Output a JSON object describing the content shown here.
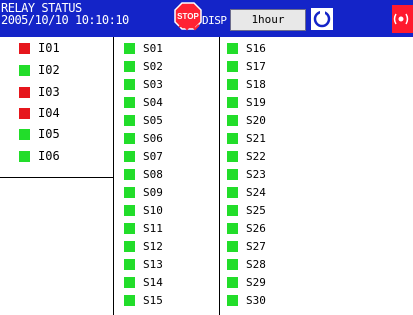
{
  "header": {
    "title": "RELAY STATUS",
    "datetime": "2005/10/10 10:10:10",
    "stop_icon_label": "STOP",
    "disp_label": "DISP",
    "disp_value": "1hour"
  },
  "colors": {
    "header_bg": "#1424c8",
    "status_on": "#22dd2a",
    "status_alarm": "#e6161c",
    "alarm_icon": "#ff1a2e"
  },
  "inputs": [
    {
      "label": "I01",
      "state": "alarm"
    },
    {
      "label": "I02",
      "state": "on"
    },
    {
      "label": "I03",
      "state": "alarm"
    },
    {
      "label": "I04",
      "state": "alarm"
    },
    {
      "label": "I05",
      "state": "on"
    },
    {
      "label": "I06",
      "state": "on"
    }
  ],
  "relays_col1": [
    {
      "label": "S01",
      "state": "on"
    },
    {
      "label": "S02",
      "state": "on"
    },
    {
      "label": "S03",
      "state": "on"
    },
    {
      "label": "S04",
      "state": "on"
    },
    {
      "label": "S05",
      "state": "on"
    },
    {
      "label": "S06",
      "state": "on"
    },
    {
      "label": "S07",
      "state": "on"
    },
    {
      "label": "S08",
      "state": "on"
    },
    {
      "label": "S09",
      "state": "on"
    },
    {
      "label": "S10",
      "state": "on"
    },
    {
      "label": "S11",
      "state": "on"
    },
    {
      "label": "S12",
      "state": "on"
    },
    {
      "label": "S13",
      "state": "on"
    },
    {
      "label": "S14",
      "state": "on"
    },
    {
      "label": "S15",
      "state": "on"
    }
  ],
  "relays_col2": [
    {
      "label": "S16",
      "state": "on"
    },
    {
      "label": "S17",
      "state": "on"
    },
    {
      "label": "S18",
      "state": "on"
    },
    {
      "label": "S19",
      "state": "on"
    },
    {
      "label": "S20",
      "state": "on"
    },
    {
      "label": "S21",
      "state": "on"
    },
    {
      "label": "S22",
      "state": "on"
    },
    {
      "label": "S23",
      "state": "on"
    },
    {
      "label": "S24",
      "state": "on"
    },
    {
      "label": "S25",
      "state": "on"
    },
    {
      "label": "S26",
      "state": "on"
    },
    {
      "label": "S27",
      "state": "on"
    },
    {
      "label": "S28",
      "state": "on"
    },
    {
      "label": "S29",
      "state": "on"
    },
    {
      "label": "S30",
      "state": "on"
    }
  ]
}
